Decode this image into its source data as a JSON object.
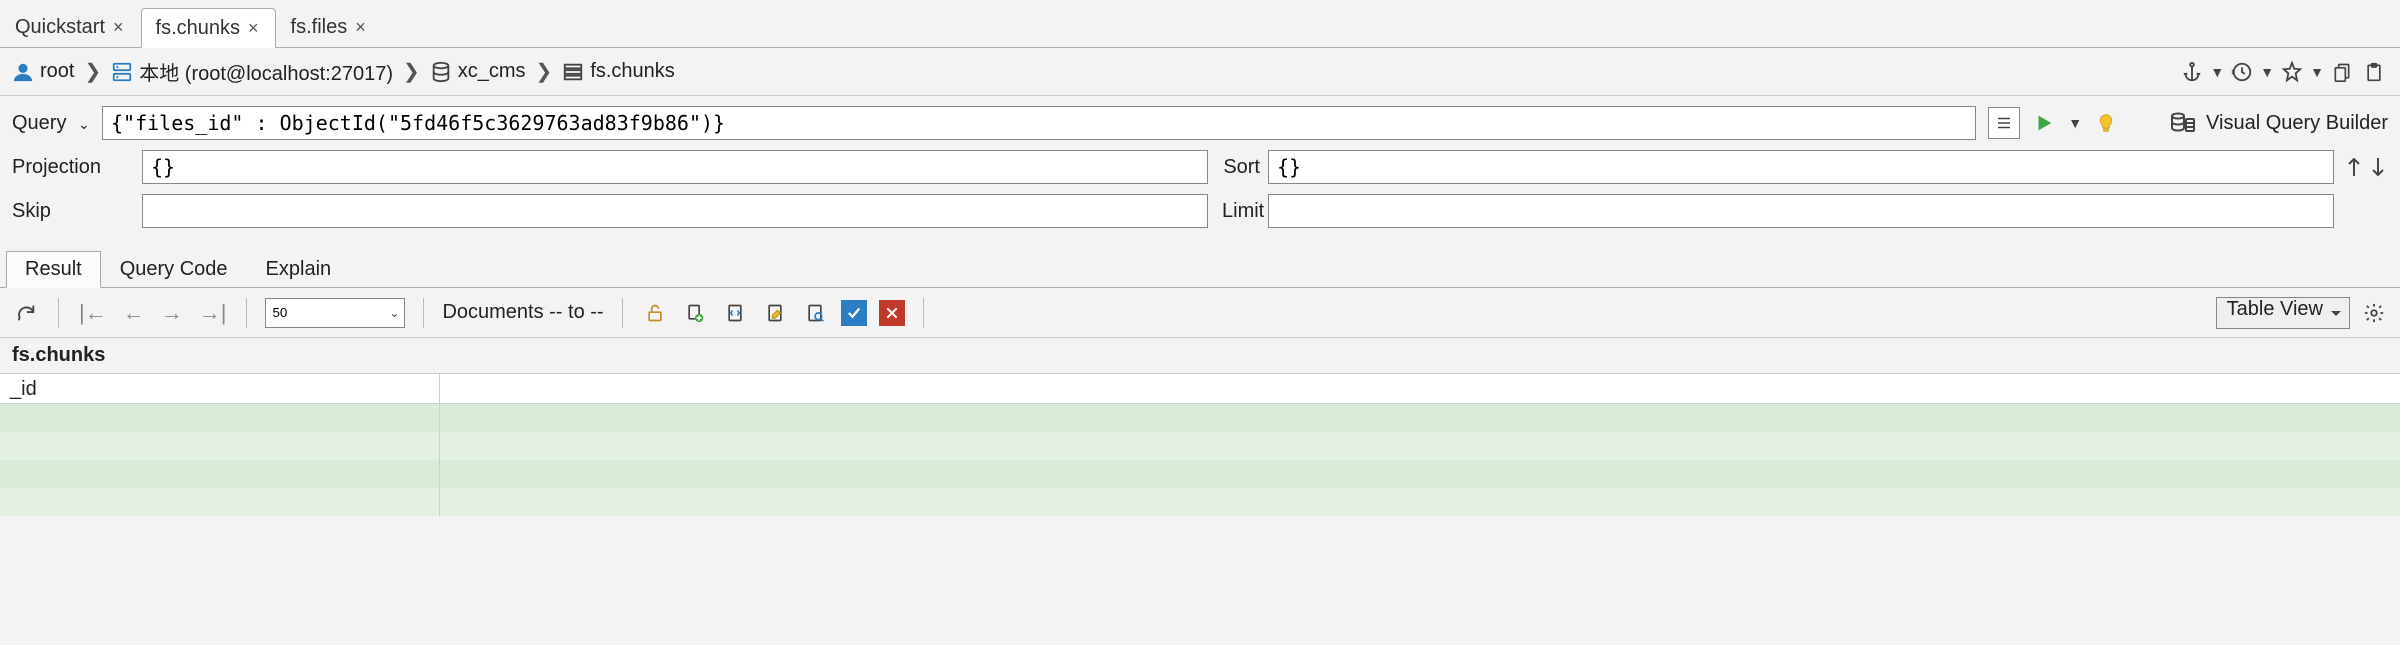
{
  "tabs": [
    {
      "label": "Quickstart",
      "active": false
    },
    {
      "label": "fs.chunks",
      "active": true
    },
    {
      "label": "fs.files",
      "active": false
    }
  ],
  "breadcrumb": {
    "user": "root",
    "connection": "本地 (root@localhost:27017)",
    "database": "xc_cms",
    "collection": "fs.chunks"
  },
  "query": {
    "label": "Query",
    "value": "{\"files_id\" : ObjectId(\"5fd46f5c3629763ad83f9b86\")}",
    "projection_label": "Projection",
    "projection_value": "{}",
    "sort_label": "Sort",
    "sort_value": "{}",
    "skip_label": "Skip",
    "skip_value": "",
    "limit_label": "Limit",
    "limit_value": ""
  },
  "visual_query_builder": "Visual Query Builder",
  "result_tabs": [
    {
      "label": "Result",
      "active": true
    },
    {
      "label": "Query Code",
      "active": false
    },
    {
      "label": "Explain",
      "active": false
    }
  ],
  "result_toolbar": {
    "page_size": "50",
    "range_text": "Documents -- to --",
    "view_label": "Table View"
  },
  "grid": {
    "collection_title": "fs.chunks",
    "columns": [
      "_id"
    ]
  },
  "colors": {
    "accent_green": "#3fa648",
    "row_green_light": "#e2f1e1",
    "row_green_dark": "#d8ecd7"
  }
}
